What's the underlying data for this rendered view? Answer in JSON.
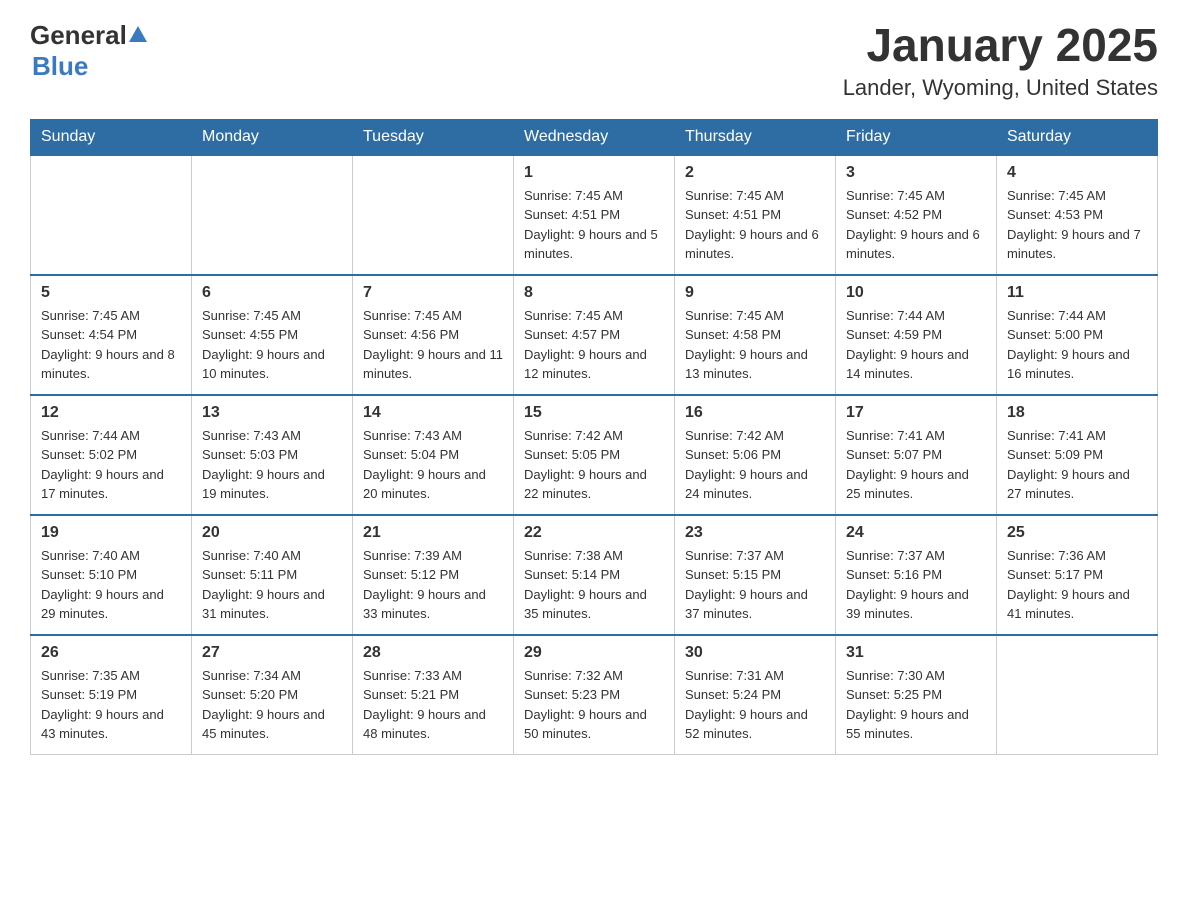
{
  "logo": {
    "general": "General",
    "blue": "Blue"
  },
  "title": "January 2025",
  "subtitle": "Lander, Wyoming, United States",
  "weekdays": [
    "Sunday",
    "Monday",
    "Tuesday",
    "Wednesday",
    "Thursday",
    "Friday",
    "Saturday"
  ],
  "weeks": [
    [
      {
        "day": "",
        "sunrise": "",
        "sunset": "",
        "daylight": ""
      },
      {
        "day": "",
        "sunrise": "",
        "sunset": "",
        "daylight": ""
      },
      {
        "day": "",
        "sunrise": "",
        "sunset": "",
        "daylight": ""
      },
      {
        "day": "1",
        "sunrise": "Sunrise: 7:45 AM",
        "sunset": "Sunset: 4:51 PM",
        "daylight": "Daylight: 9 hours and 5 minutes."
      },
      {
        "day": "2",
        "sunrise": "Sunrise: 7:45 AM",
        "sunset": "Sunset: 4:51 PM",
        "daylight": "Daylight: 9 hours and 6 minutes."
      },
      {
        "day": "3",
        "sunrise": "Sunrise: 7:45 AM",
        "sunset": "Sunset: 4:52 PM",
        "daylight": "Daylight: 9 hours and 6 minutes."
      },
      {
        "day": "4",
        "sunrise": "Sunrise: 7:45 AM",
        "sunset": "Sunset: 4:53 PM",
        "daylight": "Daylight: 9 hours and 7 minutes."
      }
    ],
    [
      {
        "day": "5",
        "sunrise": "Sunrise: 7:45 AM",
        "sunset": "Sunset: 4:54 PM",
        "daylight": "Daylight: 9 hours and 8 minutes."
      },
      {
        "day": "6",
        "sunrise": "Sunrise: 7:45 AM",
        "sunset": "Sunset: 4:55 PM",
        "daylight": "Daylight: 9 hours and 10 minutes."
      },
      {
        "day": "7",
        "sunrise": "Sunrise: 7:45 AM",
        "sunset": "Sunset: 4:56 PM",
        "daylight": "Daylight: 9 hours and 11 minutes."
      },
      {
        "day": "8",
        "sunrise": "Sunrise: 7:45 AM",
        "sunset": "Sunset: 4:57 PM",
        "daylight": "Daylight: 9 hours and 12 minutes."
      },
      {
        "day": "9",
        "sunrise": "Sunrise: 7:45 AM",
        "sunset": "Sunset: 4:58 PM",
        "daylight": "Daylight: 9 hours and 13 minutes."
      },
      {
        "day": "10",
        "sunrise": "Sunrise: 7:44 AM",
        "sunset": "Sunset: 4:59 PM",
        "daylight": "Daylight: 9 hours and 14 minutes."
      },
      {
        "day": "11",
        "sunrise": "Sunrise: 7:44 AM",
        "sunset": "Sunset: 5:00 PM",
        "daylight": "Daylight: 9 hours and 16 minutes."
      }
    ],
    [
      {
        "day": "12",
        "sunrise": "Sunrise: 7:44 AM",
        "sunset": "Sunset: 5:02 PM",
        "daylight": "Daylight: 9 hours and 17 minutes."
      },
      {
        "day": "13",
        "sunrise": "Sunrise: 7:43 AM",
        "sunset": "Sunset: 5:03 PM",
        "daylight": "Daylight: 9 hours and 19 minutes."
      },
      {
        "day": "14",
        "sunrise": "Sunrise: 7:43 AM",
        "sunset": "Sunset: 5:04 PM",
        "daylight": "Daylight: 9 hours and 20 minutes."
      },
      {
        "day": "15",
        "sunrise": "Sunrise: 7:42 AM",
        "sunset": "Sunset: 5:05 PM",
        "daylight": "Daylight: 9 hours and 22 minutes."
      },
      {
        "day": "16",
        "sunrise": "Sunrise: 7:42 AM",
        "sunset": "Sunset: 5:06 PM",
        "daylight": "Daylight: 9 hours and 24 minutes."
      },
      {
        "day": "17",
        "sunrise": "Sunrise: 7:41 AM",
        "sunset": "Sunset: 5:07 PM",
        "daylight": "Daylight: 9 hours and 25 minutes."
      },
      {
        "day": "18",
        "sunrise": "Sunrise: 7:41 AM",
        "sunset": "Sunset: 5:09 PM",
        "daylight": "Daylight: 9 hours and 27 minutes."
      }
    ],
    [
      {
        "day": "19",
        "sunrise": "Sunrise: 7:40 AM",
        "sunset": "Sunset: 5:10 PM",
        "daylight": "Daylight: 9 hours and 29 minutes."
      },
      {
        "day": "20",
        "sunrise": "Sunrise: 7:40 AM",
        "sunset": "Sunset: 5:11 PM",
        "daylight": "Daylight: 9 hours and 31 minutes."
      },
      {
        "day": "21",
        "sunrise": "Sunrise: 7:39 AM",
        "sunset": "Sunset: 5:12 PM",
        "daylight": "Daylight: 9 hours and 33 minutes."
      },
      {
        "day": "22",
        "sunrise": "Sunrise: 7:38 AM",
        "sunset": "Sunset: 5:14 PM",
        "daylight": "Daylight: 9 hours and 35 minutes."
      },
      {
        "day": "23",
        "sunrise": "Sunrise: 7:37 AM",
        "sunset": "Sunset: 5:15 PM",
        "daylight": "Daylight: 9 hours and 37 minutes."
      },
      {
        "day": "24",
        "sunrise": "Sunrise: 7:37 AM",
        "sunset": "Sunset: 5:16 PM",
        "daylight": "Daylight: 9 hours and 39 minutes."
      },
      {
        "day": "25",
        "sunrise": "Sunrise: 7:36 AM",
        "sunset": "Sunset: 5:17 PM",
        "daylight": "Daylight: 9 hours and 41 minutes."
      }
    ],
    [
      {
        "day": "26",
        "sunrise": "Sunrise: 7:35 AM",
        "sunset": "Sunset: 5:19 PM",
        "daylight": "Daylight: 9 hours and 43 minutes."
      },
      {
        "day": "27",
        "sunrise": "Sunrise: 7:34 AM",
        "sunset": "Sunset: 5:20 PM",
        "daylight": "Daylight: 9 hours and 45 minutes."
      },
      {
        "day": "28",
        "sunrise": "Sunrise: 7:33 AM",
        "sunset": "Sunset: 5:21 PM",
        "daylight": "Daylight: 9 hours and 48 minutes."
      },
      {
        "day": "29",
        "sunrise": "Sunrise: 7:32 AM",
        "sunset": "Sunset: 5:23 PM",
        "daylight": "Daylight: 9 hours and 50 minutes."
      },
      {
        "day": "30",
        "sunrise": "Sunrise: 7:31 AM",
        "sunset": "Sunset: 5:24 PM",
        "daylight": "Daylight: 9 hours and 52 minutes."
      },
      {
        "day": "31",
        "sunrise": "Sunrise: 7:30 AM",
        "sunset": "Sunset: 5:25 PM",
        "daylight": "Daylight: 9 hours and 55 minutes."
      },
      {
        "day": "",
        "sunrise": "",
        "sunset": "",
        "daylight": ""
      }
    ]
  ]
}
